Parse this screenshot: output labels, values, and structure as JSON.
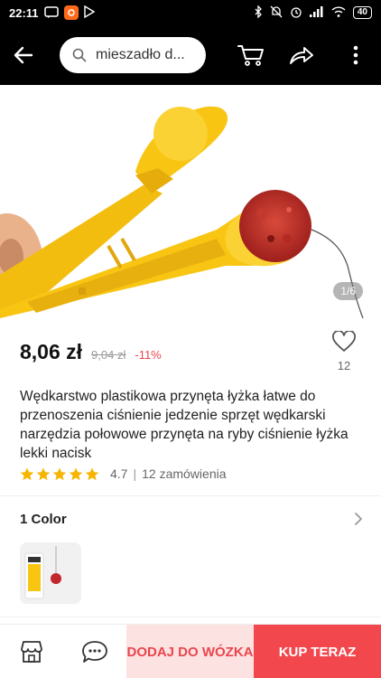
{
  "status_bar": {
    "time": "22:11",
    "battery": "40"
  },
  "header": {
    "search_value": "mieszadło d..."
  },
  "gallery": {
    "page_indicator": "1/6"
  },
  "product": {
    "price": "8,06 zł",
    "old_price": "9,04 zł",
    "discount": "-11%",
    "wishlist_count": "12",
    "title": "Wędkarstwo plastikowa przynęta łyżka łatwe do przenoszenia ciśnienie jedzenie sprzęt wędkarski narzędzia połowowe przynęta na ryby ciśnienie łyżka lekki nacisk",
    "rating": "4.7",
    "rating_value": 4.7,
    "rating_max": 5,
    "separator": "|",
    "orders": "12 zamówienia"
  },
  "variants": {
    "header": "1 Color"
  },
  "bottom_bar": {
    "add_to_cart": "DODAJ DO WÓZKA",
    "buy_now": "KUP TERAZ"
  },
  "colors": {
    "accent": "#f2474d",
    "accent_light": "#fde2e2",
    "star": "#f7b500",
    "product_yellow": "#f8c513"
  }
}
